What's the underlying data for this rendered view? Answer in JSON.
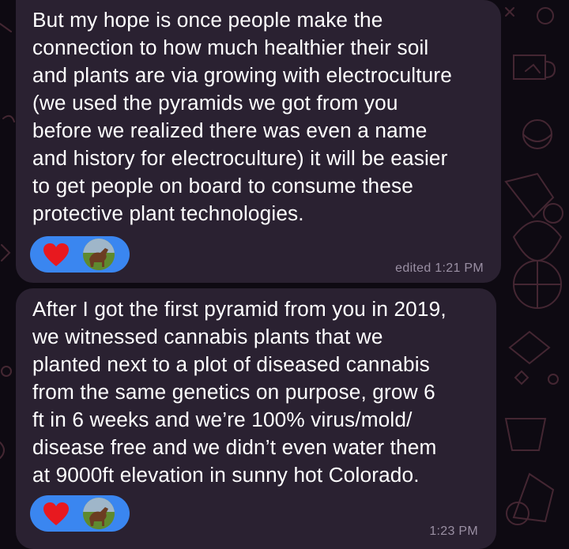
{
  "messages": [
    {
      "text": "But my hope is once people make the\nconnection to how much healthier their soil\nand plants are via growing with electroculture\n(we used the pyramids we got from you\nbefore we realized there was even a name\nand history for electroculture) it will be easier\nto get people on board to consume these\nprotective plant technologies.",
      "meta": "edited 1:21 PM",
      "reactions": [
        "heart-icon",
        "avatar"
      ]
    },
    {
      "text": "After I got the first pyramid from you in 2019,\nwe witnessed cannabis plants that we\nplanted next to a plot of diseased cannabis\nfrom the same genetics on purpose, grow 6\nft in 6 weeks and we’re 100% virus/mold/\ndisease free and we didn’t even water them\nat 9000ft elevation in sunny hot Colorado.",
      "meta": "1:23 PM",
      "reactions": [
        "heart-icon",
        "avatar"
      ]
    }
  ],
  "colors": {
    "background": "#0e0a12",
    "bubble": "#2a2131",
    "reaction_pill": "#3a86f0",
    "heart": "#e8191f",
    "meta_text": "#9a8fa3"
  }
}
